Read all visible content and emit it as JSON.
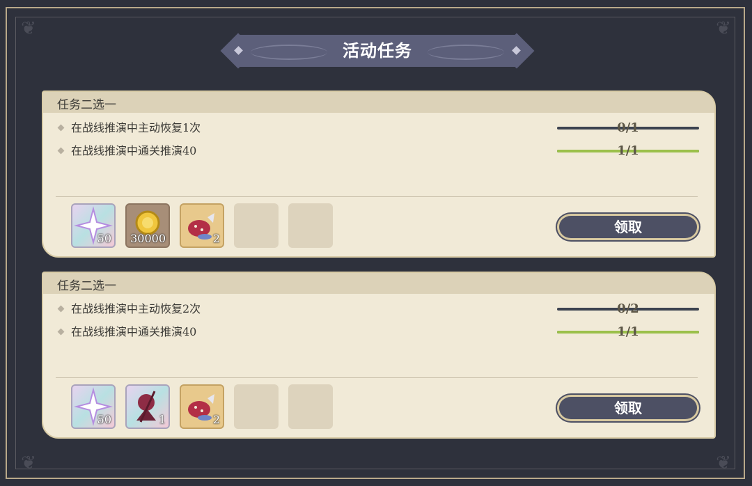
{
  "title": "活动任务",
  "panels": [
    {
      "header": "任务二选一",
      "tasks": [
        {
          "text": "在战线推演中主动恢复1次",
          "progress_text": "0/1",
          "progress": 0
        },
        {
          "text": "在战线推演中通关推演40",
          "progress_text": "1/1",
          "progress": 1
        }
      ],
      "rewards": [
        {
          "icon": "star-crystal-icon",
          "count": "50"
        },
        {
          "icon": "gold-coin-icon",
          "count": "30000"
        },
        {
          "icon": "beast-item-icon",
          "count": "2"
        }
      ],
      "claim_label": "领取"
    },
    {
      "header": "任务二选一",
      "tasks": [
        {
          "text": "在战线推演中主动恢复2次",
          "progress_text": "0/2",
          "progress": 0
        },
        {
          "text": "在战线推演中通关推演40",
          "progress_text": "1/1",
          "progress": 1
        }
      ],
      "rewards": [
        {
          "icon": "star-crystal-icon",
          "count": "50"
        },
        {
          "icon": "character-card-icon",
          "count": "1"
        },
        {
          "icon": "beast-item-icon",
          "count": "2"
        }
      ],
      "claim_label": "领取"
    }
  ],
  "colors": {
    "background": "#2e313c",
    "panel": "#f1ead7",
    "progress_fill": "#9bc04a",
    "button": "#4d5064"
  }
}
